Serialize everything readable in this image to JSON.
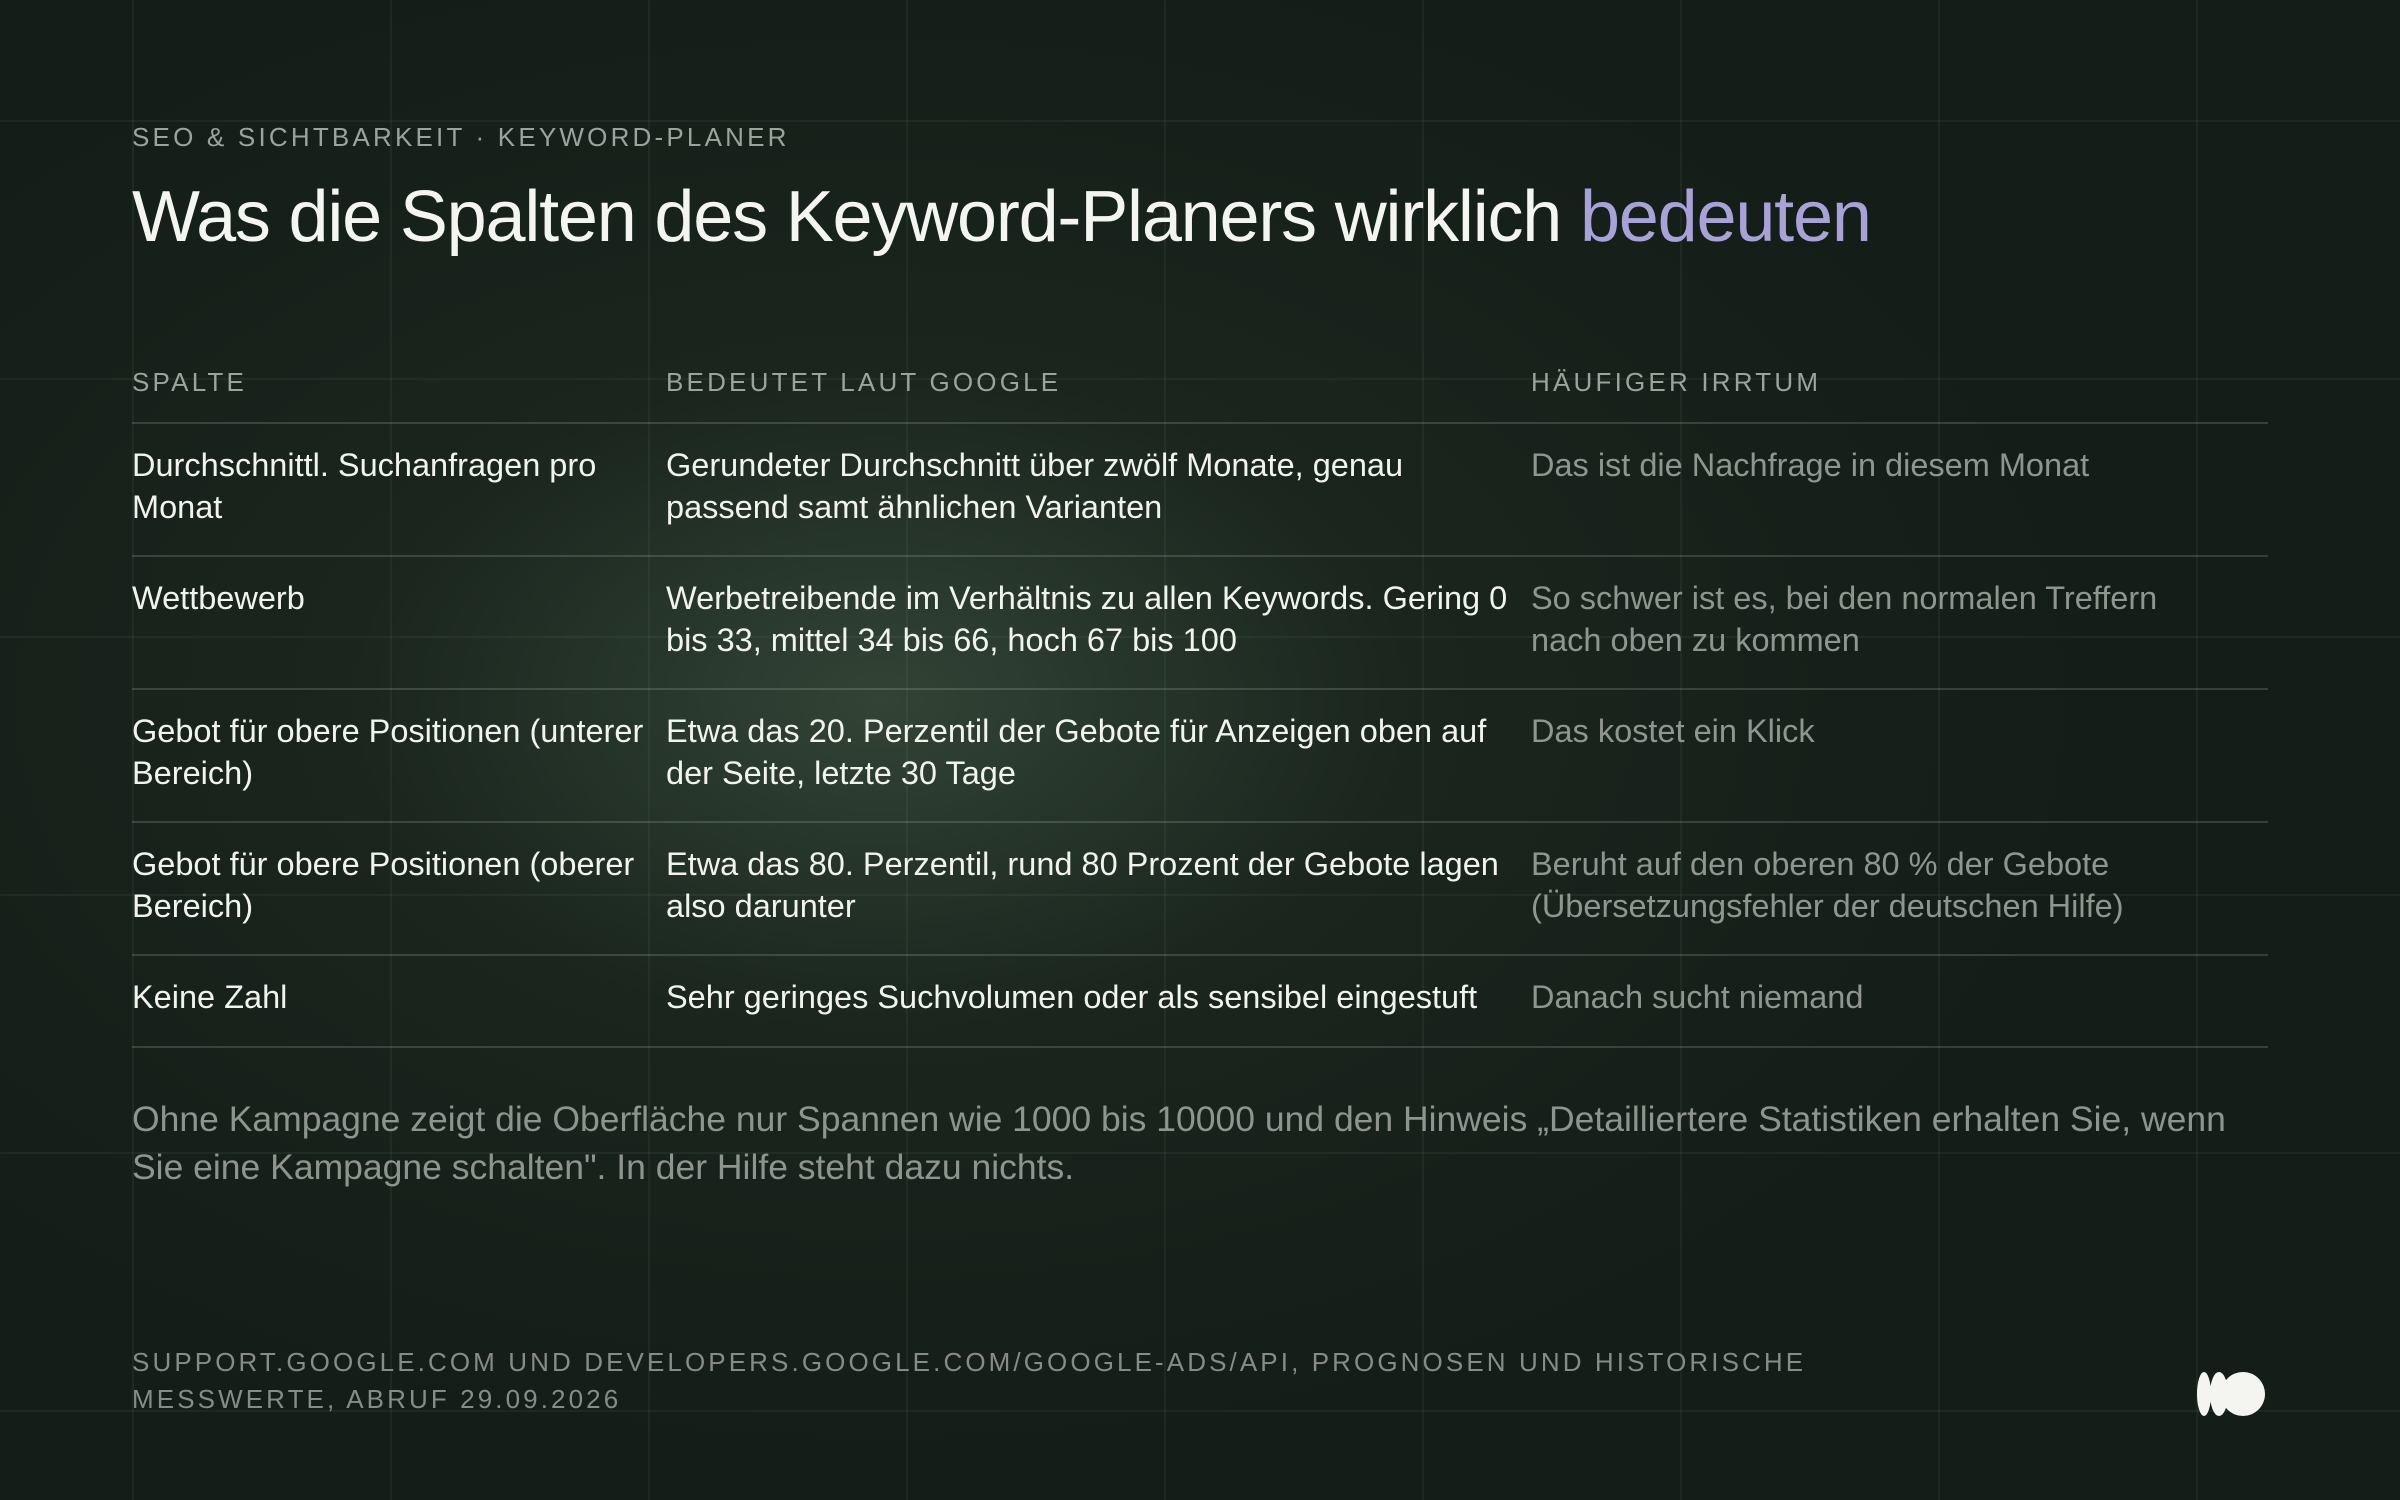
{
  "header": {
    "eyebrow": "SEO & SICHTBARKEIT · KEYWORD-PLANER",
    "title_main": "Was die Spalten des Keyword-Planers wirklich ",
    "title_accent": "bedeuten"
  },
  "table": {
    "columns": [
      "SPALTE",
      "BEDEUTET LAUT GOOGLE",
      "HÄUFIGER IRRTUM"
    ],
    "rows": [
      {
        "term": "Durchschnittl. Suchanfragen pro Monat",
        "meaning": "Gerundeter Durchschnitt über zwölf Monate, genau passend samt ähnlichen Varianten",
        "misconception": "Das ist die Nachfrage in diesem Monat"
      },
      {
        "term": "Wettbewerb",
        "meaning": "Werbetreibende im Verhältnis zu allen Keywords. Gering 0 bis 33, mittel 34 bis 66, hoch 67 bis 100",
        "misconception": "So schwer ist es, bei den normalen Treffern nach oben zu kommen"
      },
      {
        "term": "Gebot für obere Positionen (unterer Bereich)",
        "meaning": "Etwa das 20. Perzentil der Gebote für Anzeigen oben auf der Seite, letzte 30 Tage",
        "misconception": "Das kostet ein Klick"
      },
      {
        "term": "Gebot für obere Positionen (oberer Bereich)",
        "meaning": "Etwa das 80. Perzentil, rund 80 Prozent der Gebote lagen also darunter",
        "misconception": "Beruht auf den oberen 80 % der Gebote (Übersetzungsfehler der deutschen Hilfe)"
      },
      {
        "term": "Keine Zahl",
        "meaning": "Sehr geringes Suchvolumen oder als sensibel eingestuft",
        "misconception": "Danach sucht niemand"
      }
    ]
  },
  "note": "Ohne Kampagne zeigt die Oberfläche nur Spannen wie 1000 bis 10000 und den Hinweis „Detailliertere Statistiken erhalten Sie, wenn Sie eine Kampagne schalten\". In der Hilfe steht dazu nichts.",
  "source": "SUPPORT.GOOGLE.COM UND DEVELOPERS.GOOGLE.COM/GOOGLE-ADS/API, PROGNOSEN UND HISTORISCHE MESSWERTE, ABRUF 29.09.2026",
  "logo_icon": "brand-logo-icon",
  "colors": {
    "background": "#141d18",
    "accent": "#a9a2d6",
    "text": "#f1f3ee",
    "muted": "#8f968f"
  }
}
